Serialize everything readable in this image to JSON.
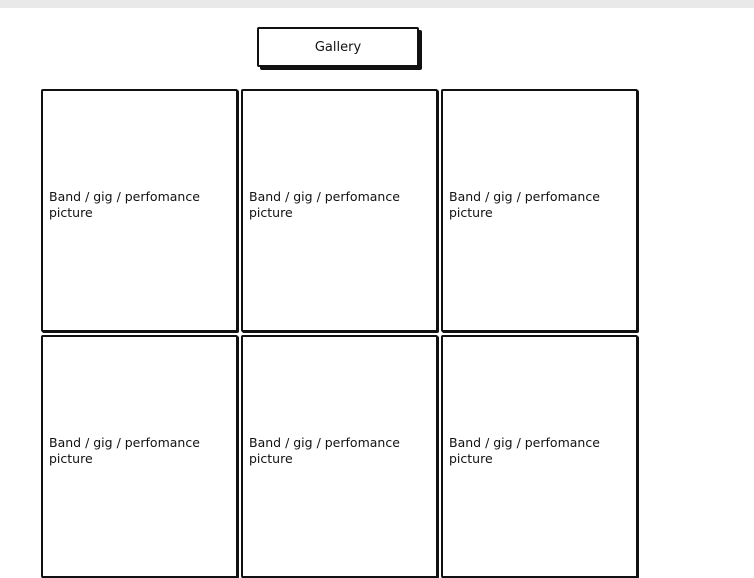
{
  "header": {
    "gallery_label": "Gallery"
  },
  "gallery": {
    "tiles": [
      {
        "caption": "Band / gig / perfomance picture"
      },
      {
        "caption": "Band / gig / perfomance picture"
      },
      {
        "caption": "Band / gig / perfomance picture"
      },
      {
        "caption": "Band / gig / perfomance picture"
      },
      {
        "caption": "Band / gig / perfomance picture"
      },
      {
        "caption": "Band / gig / perfomance picture"
      }
    ]
  }
}
